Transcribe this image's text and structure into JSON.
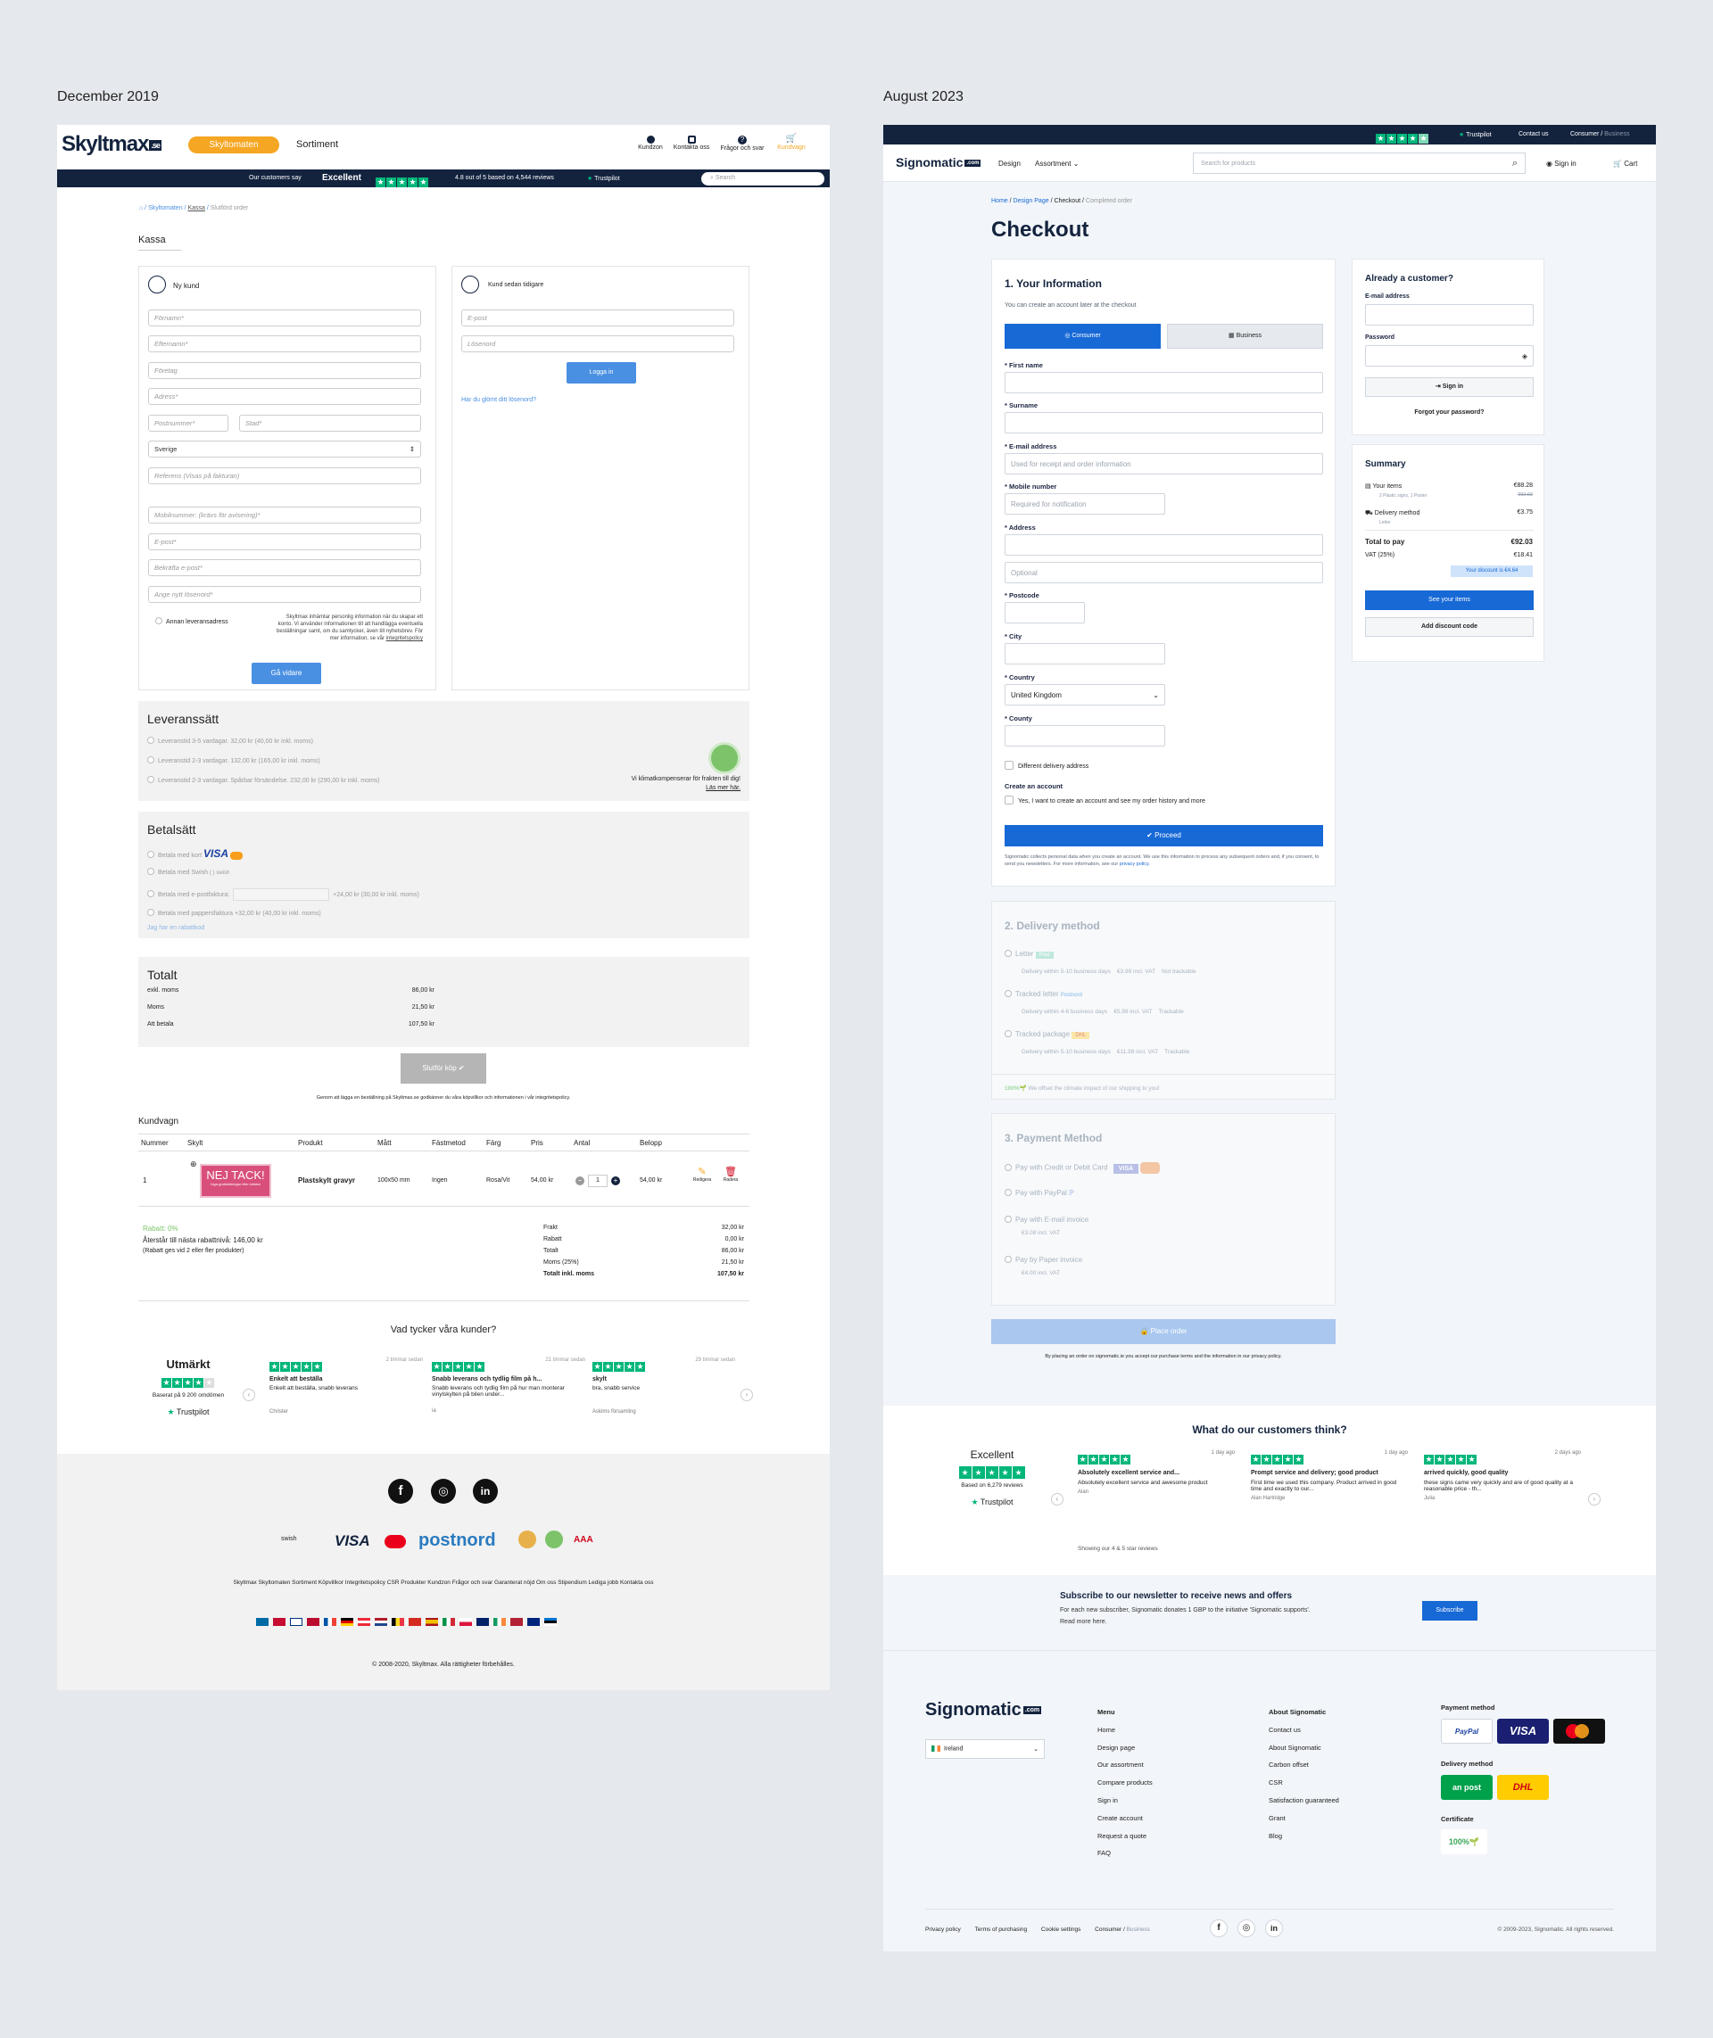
{
  "captions": {
    "left": "December 2019",
    "right": "August 2023"
  },
  "old": {
    "logo": "Skyltmax",
    "logo_badge": ".se",
    "nav_pill": "Skyltomaten",
    "nav_link": "Sortiment",
    "icons": [
      "Kundzon",
      "Kontakta oss",
      "Frågor och svar",
      "Kundvagn"
    ],
    "tp_bar": {
      "say": "Our customers say",
      "excellent": "Excellent",
      "score": "4.8 out of 5 based on 4,544 reviews",
      "brand": "Trustpilot",
      "search": "Search"
    },
    "breadcrumb": [
      "Skyltomaten",
      "Kassa",
      "Slutförd order"
    ],
    "title": "Kassa",
    "new_customer": {
      "title": "Ny kund",
      "fields": [
        "Förnamn*",
        "Efternamn*",
        "Företag",
        "Adress*",
        "Postnummer*",
        "Stad*",
        "Sverige",
        "Referens (Visas på fakturan)",
        "Mobilnummer: (krävs för avisering)*",
        "E-post*",
        "Bekräfta e-post*",
        "Ange nytt lösenord*"
      ],
      "alt_addr": "Annan leveransadress",
      "privacy": "Skyltmax inhämtar personlig information när du skapar ett konto. Vi använder informationen till att handlägga eventuella beställningar samt, om du samtycker, även till nyhetsbrev. För mer information, se vår",
      "privacy_link": "integritetspolicy",
      "button": "Gå vidare"
    },
    "returning": {
      "title": "Kund sedan tidigare",
      "email": "E-post",
      "password": "Lösenord",
      "button": "Logga in",
      "forgot": "Har du glömt ditt lösenord?"
    },
    "delivery": {
      "title": "Leveranssätt",
      "options": [
        "Leveranstid 3-5 vardagar. 32,00 kr (40,00 kr inkl. moms)",
        "Leveranstid 2-3 vardagar. 132,00 kr (165,00 kr inkl. moms)",
        "Leveranstid 2-3 vardagar. Spårbar försändelse. 232,00 kr (290,00 kr inkl. moms)"
      ],
      "climate": "Vi klimatkompenserar för frakten till dig!",
      "read_more": "Läs mer här."
    },
    "payment": {
      "title": "Betalsätt",
      "options": [
        "Betala med kort",
        "Betala med Swish",
        "Betala med e-postfaktura:",
        "Betala med pappersfaktura +32,00 kr (40,00 kr inkl. moms)"
      ],
      "visa": "VISA",
      "swish": "swish",
      "efaktura_fee": "+24,00 kr (30,00 kr inkl. moms)",
      "discount": "Jag har en rabattkod"
    },
    "total": {
      "title": "Totalt",
      "rows": [
        [
          "exkl. moms",
          "86,00 kr"
        ],
        [
          "Moms",
          "21,50 kr"
        ],
        [
          "Att betala",
          "107,50 kr"
        ]
      ],
      "button": "Slutför köp",
      "terms": "Genom att lägga en beställning på Skyltmax.se godkänner du våra köpvillkor och informationen i vår integritetspolicy."
    },
    "cart": {
      "title": "Kundvagn",
      "headers": [
        "Nummer",
        "Skylt",
        "Produkt",
        "Mått",
        "Fästmetod",
        "Färg",
        "Pris",
        "Antal",
        "Belopp"
      ],
      "row": [
        "1",
        "Plastskylt gravyr",
        "100x50 mm",
        "Ingen",
        "Rosa/Vit",
        "54,00 kr",
        "1",
        "54,00 kr"
      ],
      "sign_text": "NEJ TACK!",
      "sign_sub": "Inga gratistidningar eller reklam",
      "edit": "Redigera",
      "delete": "Radera",
      "rebate": "Rabatt: 0%",
      "rebate_next": "Återstår till nästa rabattnivå: 146,00 kr",
      "rebate_note": "(Rabatt ges vid 2 eller fler produkter)",
      "sums": [
        [
          "Frakt",
          "32,00 kr"
        ],
        [
          "Rabatt",
          "0,00 kr"
        ],
        [
          "Totalt",
          "86,00 kr"
        ],
        [
          "Moms (25%)",
          "21,50 kr"
        ],
        [
          "Totalt inkl. moms",
          "107,50 kr"
        ]
      ]
    },
    "reviews": {
      "title": "Vad tycker våra kunder?",
      "rating": "Utmärkt",
      "based": "Baserat på 9 200 omdömen",
      "brand": "Trustpilot",
      "items": [
        {
          "time": "2 timmar sedan",
          "title": "Enkelt att beställa",
          "text": "Enkelt att beställa, snabb leverans",
          "author": "Christer"
        },
        {
          "time": "21 timmar sedan",
          "title": "Snabb leverans och tydlig film på h...",
          "text": "Snabb leverans och tydlig film på hur man monterar vinylskylten på bilen under...",
          "author": "ia"
        },
        {
          "time": "29 timmar sedan",
          "title": "skylt",
          "text": "bra, snabb service",
          "author": "Askims församling"
        }
      ]
    },
    "footer": {
      "payments": [
        "swish",
        "VISA",
        "postnord",
        "AAA"
      ],
      "links": "Skyltmax  Skyltomaten  Sortiment  Köpvillkor  Integritetspolicy  CSR  Produkter  Kundzon  Frågor och svar  Garanterat nöjd  Om oss  Stipendium  Lediga jobb  Kontakta oss",
      "copyright": "© 2008-2020, Skyltmax. Alla rättigheter förbehålles."
    }
  },
  "new": {
    "top": {
      "brand": "Trustpilot",
      "contact": "Contact us",
      "consumer": "Consumer",
      "business": "Business"
    },
    "logo": "Signomatic",
    "logo_badge": ".com",
    "nav": [
      "Design",
      "Assortment"
    ],
    "search": "Search for products",
    "sign_in": "Sign in",
    "cart": "Cart",
    "breadcrumb": [
      "Home",
      "Design Page",
      "Checkout",
      "Completed order"
    ],
    "title": "Checkout",
    "info": {
      "title": "1. Your Information",
      "sub": "You can create an account later at the checkout",
      "consumer": "Consumer",
      "business": "Business",
      "labels": [
        "* First name",
        "* Surname",
        "* E-mail address",
        "* Mobile number",
        "* Address",
        "* Postcode",
        "* City",
        "* Country",
        "* County"
      ],
      "email_ph": "Used for receipt and order information",
      "mobile_ph": "Required for notification",
      "optional": "Optional",
      "country": "United Kingdom",
      "diff": "Different delivery address",
      "create": "Create an account",
      "create_opt": "Yes, I want to create an account and see my order history and more",
      "proceed": "Proceed",
      "privacy": "Signomatic collects personal data when you create an account. We use this information to process any subsequent orders and, if you consent, to send you newsletters. For more information, see our",
      "privacy_link": "privacy policy."
    },
    "delivery": {
      "title": "2. Delivery method",
      "options": [
        {
          "name": "Letter",
          "tag": "Post",
          "meta": "Delivery within 5-10 business days    €3.99 incl. VAT    Not trackable"
        },
        {
          "name": "Tracked letter",
          "tag": "Postnord",
          "meta": "Delivery within 4-6 business days    €5.99 incl. VAT    Trackable"
        },
        {
          "name": "Tracked package",
          "tag": "DHL",
          "meta": "Delivery within 5-10 business days    €11.99 incl. VAT    Trackable"
        }
      ],
      "climate": "We offset the climate impact of our shipping to you!"
    },
    "payment": {
      "title": "3. Payment Method",
      "options": [
        "Pay with Credit or Debit Card",
        "Pay with PayPal",
        "Pay with E-mail invoice",
        "Pay by Paper invoice"
      ],
      "subs": [
        "",
        "",
        "€3.08 incl. VAT",
        "€4.00 incl. VAT"
      ],
      "visa": "VISA"
    },
    "place": "Place order",
    "terms": "By placing an order on signomatic.ie you accept our purchase terms and the information in our privacy policy.",
    "already": {
      "title": "Already a customer?",
      "email": "E-mail address",
      "password": "Password",
      "sign_in": "Sign in",
      "forgot": "Forgot your password?"
    },
    "summary": {
      "title": "Summary",
      "items": "Your items",
      "items_sub": "2 Plastic signs, 1 Poster",
      "items_price": "€88.28",
      "items_old": "€92.92",
      "delivery": "Delivery method",
      "delivery_sub": "Letter",
      "delivery_price": "€3.75",
      "total": "Total to pay",
      "total_price": "€92.03",
      "vat": "VAT (25%)",
      "vat_price": "€18.41",
      "discount_badge": "Your discount is €4.64",
      "see": "See your items",
      "add_code": "Add discount code"
    },
    "reviews": {
      "title": "What do our customers think?",
      "rating": "Excellent",
      "based": "Based on 6,279 reviews",
      "brand": "Trustpilot",
      "showing": "Showing our 4 & 5 star reviews",
      "items": [
        {
          "time": "1 day ago",
          "title": "Absolutely excellent service and...",
          "text": "Absolutely excellent service and awesome product",
          "author": "Alan"
        },
        {
          "time": "1 day ago",
          "title": "Prompt service and delivery; good product",
          "text": "First time we used this company. Product arrived in good time and exactly to our...",
          "author": "Alan Hartridge"
        },
        {
          "time": "2 days ago",
          "title": "arrived quickly, good quality",
          "text": "these signs came very quickly and are of good quality at a reasonable price - th...",
          "author": "Julia"
        }
      ]
    },
    "newsletter": {
      "title": "Subscribe to our newsletter to receive news and offers",
      "text": "For each new subscriber, Signomatic donates 1 GBP to the initiative 'Signomatic supports'.",
      "more": "Read more here.",
      "button": "Subscribe"
    },
    "footer": {
      "country": "Ireland",
      "col1": [
        "Menu",
        "Home",
        "Design page",
        "Our assortment",
        "Compare products",
        "Sign in",
        "Create account",
        "Request a quote",
        "FAQ"
      ],
      "col2": [
        "About Signomatic",
        "Contact us",
        "About Signomatic",
        "Carbon offset",
        "CSR",
        "Satisfaction guaranteed",
        "Grant",
        "Blog"
      ],
      "payment_title": "Payment method",
      "delivery_title": "Delivery method",
      "cert_title": "Certificate",
      "paypal": "PayPal",
      "visa": "VISA",
      "post": "an post",
      "dhl": "DHL",
      "cert": "100%",
      "bottom": [
        "Privacy policy",
        "Terms of purchasing",
        "Cookie settings",
        "Consumer",
        "Business"
      ],
      "copyright": "© 2009-2023, Signomatic. All rights reserved."
    }
  },
  "colors": {
    "skyltmax_orange": "#f5a623",
    "skyltmax_navy": "#13233e",
    "signomatic_blue": "#1769d6",
    "trustpilot_green": "#00b67a"
  }
}
